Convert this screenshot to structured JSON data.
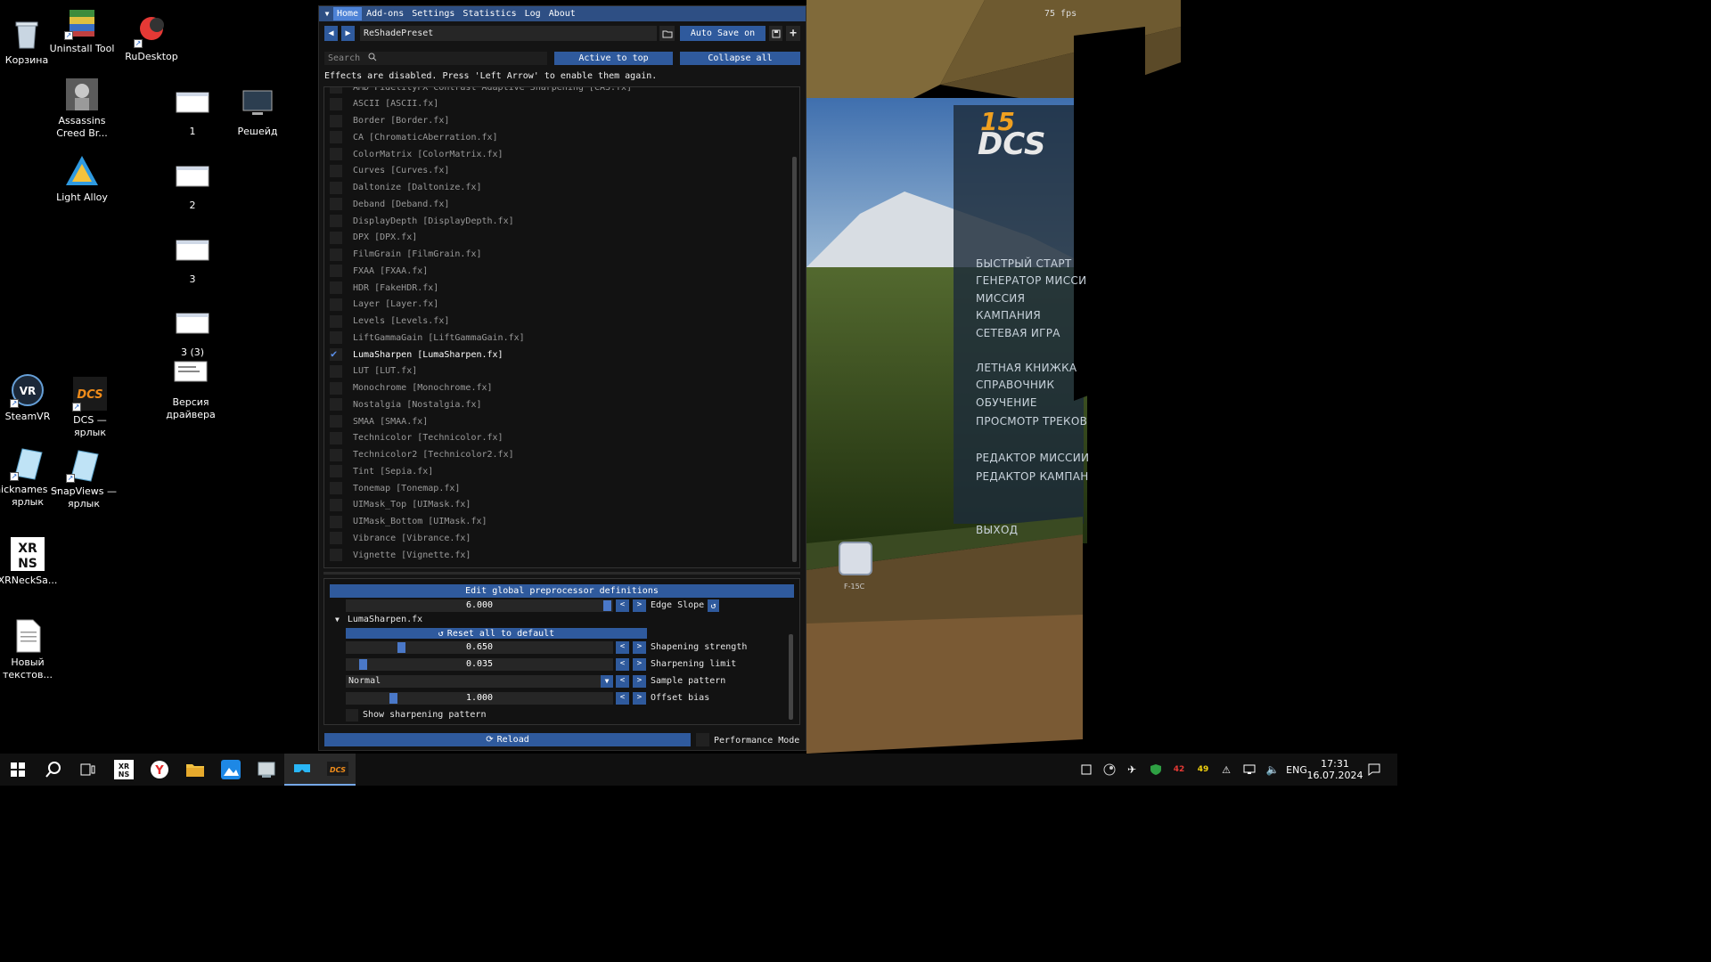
{
  "desktop": {
    "icons": [
      {
        "label": "Корзина"
      },
      {
        "label": "Uninstall Tool"
      },
      {
        "label": "RuDesktop"
      },
      {
        "label": "Assassins Creed Br..."
      },
      {
        "label": "1"
      },
      {
        "label": "Решейд"
      },
      {
        "label": "Light Alloy"
      },
      {
        "label": "2"
      },
      {
        "label": "3"
      },
      {
        "label": "3 (3)"
      },
      {
        "label": "Версия драйвера"
      },
      {
        "label": "SteamVR"
      },
      {
        "label": "DCS — ярлык"
      },
      {
        "label": "nicknames — ярлык"
      },
      {
        "label": "SnapViews — ярлык"
      },
      {
        "label": "XRNeckSa..."
      },
      {
        "label": "Новый текстов..."
      }
    ]
  },
  "reshade": {
    "menu": [
      "Home",
      "Add-ons",
      "Settings",
      "Statistics",
      "Log",
      "About"
    ],
    "active_menu": "Home",
    "preset_name": "ReShadePreset",
    "auto_save_label": "Auto Save on",
    "search_placeholder": "Search",
    "active_to_top_label": "Active to top",
    "collapse_all_label": "Collapse all",
    "notice": "Effects are disabled. Press 'Left Arrow' to enable them again.",
    "effects": [
      {
        "name": "AMD FidelityFX Contrast Adaptive Sharpening [CAS.fx]",
        "enabled": false
      },
      {
        "name": "ASCII [ASCII.fx]",
        "enabled": false
      },
      {
        "name": "Border [Border.fx]",
        "enabled": false
      },
      {
        "name": "CA [ChromaticAberration.fx]",
        "enabled": false
      },
      {
        "name": "ColorMatrix [ColorMatrix.fx]",
        "enabled": false
      },
      {
        "name": "Curves [Curves.fx]",
        "enabled": false
      },
      {
        "name": "Daltonize [Daltonize.fx]",
        "enabled": false
      },
      {
        "name": "Deband [Deband.fx]",
        "enabled": false
      },
      {
        "name": "DisplayDepth [DisplayDepth.fx]",
        "enabled": false
      },
      {
        "name": "DPX [DPX.fx]",
        "enabled": false
      },
      {
        "name": "FilmGrain [FilmGrain.fx]",
        "enabled": false
      },
      {
        "name": "FXAA [FXAA.fx]",
        "enabled": false
      },
      {
        "name": "HDR [FakeHDR.fx]",
        "enabled": false
      },
      {
        "name": "Layer [Layer.fx]",
        "enabled": false
      },
      {
        "name": "Levels [Levels.fx]",
        "enabled": false
      },
      {
        "name": "LiftGammaGain [LiftGammaGain.fx]",
        "enabled": false
      },
      {
        "name": "LumaSharpen [LumaSharpen.fx]",
        "enabled": true
      },
      {
        "name": "LUT [LUT.fx]",
        "enabled": false
      },
      {
        "name": "Monochrome [Monochrome.fx]",
        "enabled": false
      },
      {
        "name": "Nostalgia [Nostalgia.fx]",
        "enabled": false
      },
      {
        "name": "SMAA [SMAA.fx]",
        "enabled": false
      },
      {
        "name": "Technicolor [Technicolor.fx]",
        "enabled": false
      },
      {
        "name": "Technicolor2 [Technicolor2.fx]",
        "enabled": false
      },
      {
        "name": "Tint [Sepia.fx]",
        "enabled": false
      },
      {
        "name": "Tonemap [Tonemap.fx]",
        "enabled": false
      },
      {
        "name": "UIMask_Top [UIMask.fx]",
        "enabled": false
      },
      {
        "name": "UIMask_Bottom [UIMask.fx]",
        "enabled": false
      },
      {
        "name": "Vibrance [Vibrance.fx]",
        "enabled": false
      },
      {
        "name": "Vignette [Vignette.fx]",
        "enabled": false
      }
    ],
    "params": {
      "global_defs_label": "Edit global preprocessor definitions",
      "edge_slope": {
        "value": "6.000",
        "label": "Edge Slope"
      },
      "section_title": "LumaSharpen.fx",
      "reset_label": "Reset all to default",
      "sharpening_strength": {
        "value": "0.650",
        "label": "Shapening strength",
        "fill": 0.2
      },
      "sharpening_limit": {
        "value": "0.035",
        "label": "Sharpening limit",
        "fill": 0.05
      },
      "sample_pattern": {
        "value": "Normal",
        "label": "Sample pattern"
      },
      "offset_bias": {
        "value": "1.000",
        "label": "Offset bias",
        "fill": 0.17
      },
      "show_pattern_label": "Show sharpening pattern"
    },
    "reload_label": "Reload",
    "performance_mode_label": "Performance Mode"
  },
  "game": {
    "fps": "75 fps",
    "logo_big": "DCS",
    "logo_num": "15",
    "menu_items": [
      "БЫСТРЫЙ СТАРТ",
      "ГЕНЕРАТОР МИССИ",
      "МИССИЯ",
      "КАМПАНИЯ",
      "СЕТЕВАЯ ИГРА",
      "ЛЕТНАЯ КНИЖКА",
      "СПРАВОЧНИК",
      "ОБУЧЕНИЕ",
      "ПРОСМОТР ТРЕКОВ",
      "РЕДАКТОР МИССИИ",
      "РЕДАКТОР КАМПАН",
      "ВЫХОД"
    ],
    "aircraft_label": "F-15C"
  },
  "taskbar": {
    "language": "ENG",
    "time": "17:31",
    "date": "16.07.2024"
  }
}
